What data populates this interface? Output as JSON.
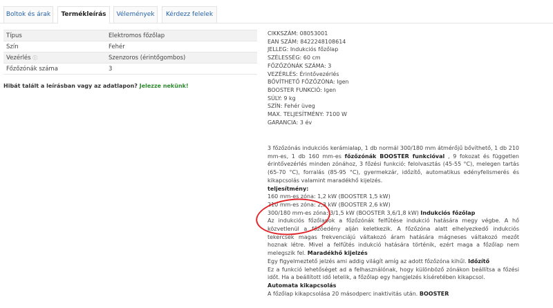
{
  "tabs": [
    {
      "label": "Boltok és árak"
    },
    {
      "label": "Termékleírás"
    },
    {
      "label": "Vélemények"
    },
    {
      "label": "Kérdezz felelek"
    }
  ],
  "properties": [
    {
      "key": "Típus",
      "value": "Elektromos főzőlap"
    },
    {
      "key": "Szín",
      "value": "Fehér"
    },
    {
      "key": "Vezérlés",
      "value": "Szenzoros (érintőgombos)",
      "info_icon": "info-icon"
    },
    {
      "key": "Főzőzónák száma",
      "value": "3"
    }
  ],
  "error_report": {
    "text": "Hibát talált a leírásban vagy az adatlapon?",
    "link": "Jelezze nekünk!"
  },
  "specs": [
    "CIKKSZÁM: 08053001",
    "EAN SZÁM: 8422248108614",
    "JELLEG: Indukciós főzőlap",
    "SZÉLESSÉG: 60 cm",
    "FŐZŐZÓNÁK SZÁMA: 3",
    "VEZÉRLÉS: Érintővezérlés",
    "BŐVÍTHETŐ FŐZŐZÓNA: Igen",
    "BOOSTER FUNKCIÓ: Igen",
    "SÚLY: 9 kg",
    "SZÍN: Fehér üveg",
    "MAX. TELJESÍTMÉNY: 7100 W",
    "GARANCIA: 3 év"
  ],
  "description": {
    "intro_1": "3 főzőzónás indukciós kerámialap, 1 db normál 300/180 mm átmérőjű bővíthető, 1 db 210 mm-es, 1 db 160 mm-es ",
    "intro_bold": "főzőzónák BOOSTER funkcióval",
    "intro_2": " , 9 fokozat és független érintővezérlés minden zónához, 3 főzési funkció: felolvasztás (45-55 °C), melegen tartás (65-70 °C), forralás (85-95 °C), gyermekzár, időzítő, automatikus edényfelismerés és kikapcsolás valamint maradékhő kijelzés.",
    "power_heading": "teljesítmény:",
    "zone_1": "160 mm-es zóna: 1,2 kW (BOOSTER 1,5 kW)",
    "zone_2": "210 mm-es zóna: 2,3 kW (BOOSTER 2,6 kW)",
    "zone_3": "300/180 mm-es zóna: 3/1,5 kW (BOOSTER 3,6/1,8 kW) ",
    "induction_heading": "Indukciós főzőlap",
    "induction_text": "Az indukciós főzőlapok a főzőzónák felfűtése indukció hatására megy végbe. A hő közvetlenül a főzőedény alján keletkezik. A főzőzóna alatt elhelyezkedő indukciós tekercsek magas frekvenciájú váltakozó áram hatására mágneses váltakozó mezőt hoznak létre. Mivel a felfűtés indukció hatására történik, ezért maga a főzőlap nem melegszik fel. ",
    "residual_heading": "Maradékhő kijelzés",
    "residual_text": "Egy figyelmeztető jelzés ami addig világít amíg az adott főzőzóna kihűl. ",
    "timer_heading": "Időzítő",
    "timer_text": "Ez a funkció lehetőséget ad a felhasználónak, hogy különböző zónákon beállítsa a főzési időt. Ha a beállított idő letelik, a főzőlap egy hangjelzés kíséretében kikapcsol.",
    "auto_off_heading": "Automata kikapcsolás",
    "auto_off_text": "A főzőlap kikapcsolása 20 másodperc inaktivitás után. ",
    "booster_heading": "BOOSTER"
  },
  "colors": {
    "accent": "#2563a8",
    "link_green": "#2f8a2f",
    "annotation_red": "#e0262b"
  }
}
